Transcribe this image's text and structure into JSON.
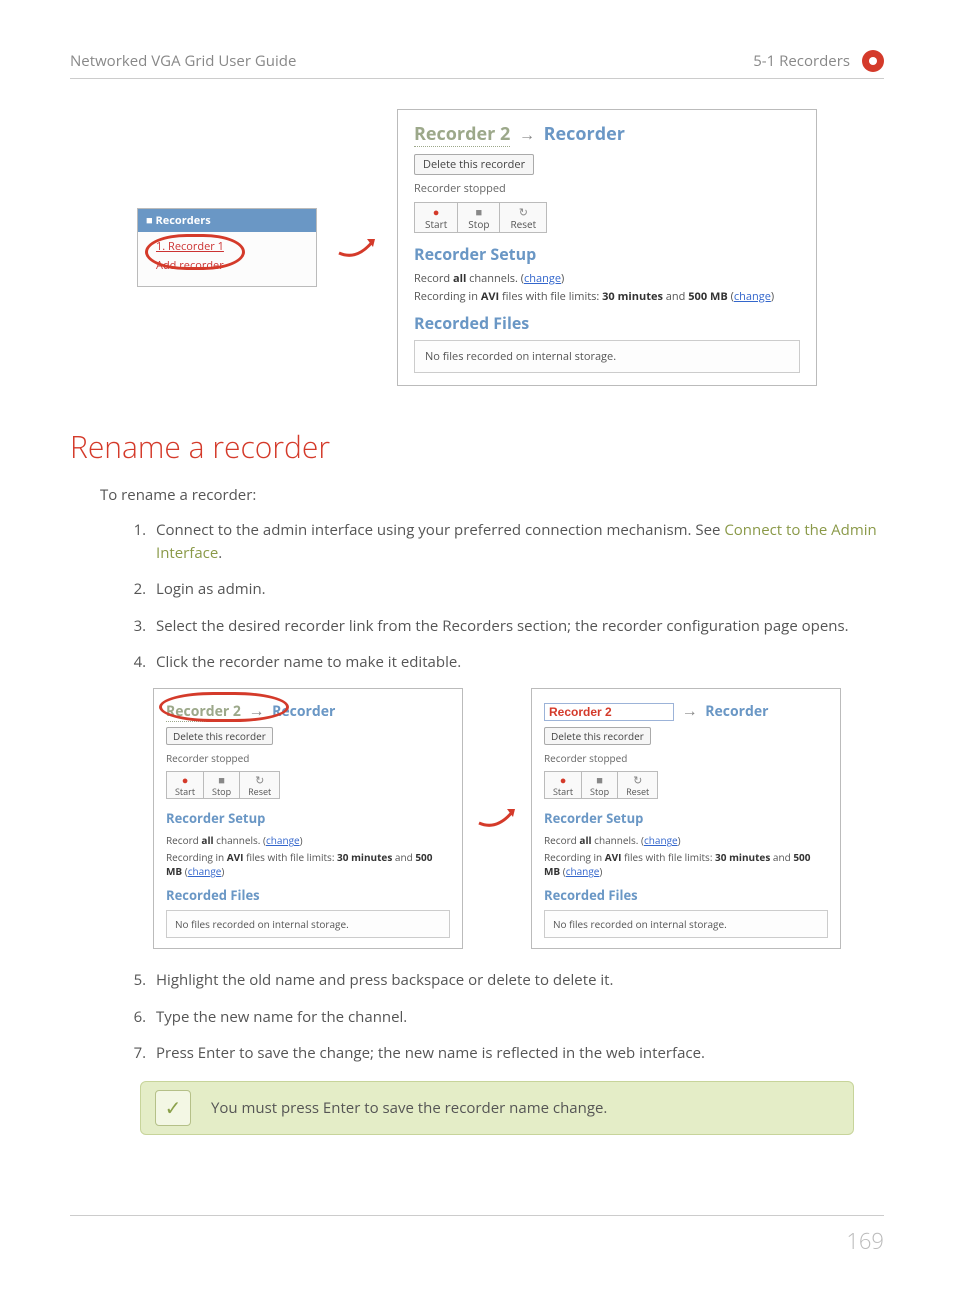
{
  "header": {
    "left": "Networked VGA Grid User Guide",
    "right": "5-1 Recorders"
  },
  "sidebar": {
    "title": "Recorders",
    "item1": "1. Recorder 1",
    "add": "Add recorder"
  },
  "panel": {
    "breadcrumb_link": "Recorder 2",
    "breadcrumb_current": "Recorder",
    "delete_btn": "Delete this recorder",
    "status": "Recorder stopped",
    "start": "Start",
    "stop": "Stop",
    "reset": "Reset",
    "setup_title": "Recorder Setup",
    "line1_a": "Record ",
    "line1_b": "all",
    "line1_c": " channels.  (",
    "change": "change",
    "line1_d": ")",
    "line2_a": "Recording in ",
    "line2_b": "AVI",
    "line2_c": " files with file limits: ",
    "line2_d": "30 minutes",
    "line2_e": " and ",
    "line2_f": "500 MB",
    "line2_g": "  (",
    "line2_h": ")",
    "files_title": "Recorded Files",
    "no_files": "No files recorded on internal storage."
  },
  "edit_value": "Recorder 2",
  "heading": "Rename a recorder",
  "intro": "To rename a recorder:",
  "steps": {
    "s1a": "Connect to the admin interface using your preferred connection mechanism. See ",
    "s1b": "Connect to the Admin Interface",
    "s1c": ".",
    "s2": "Login as admin.",
    "s3": "Select the desired recorder link from the Recorders section; the recorder configuration page opens.",
    "s4": "Click the recorder name to make it editable.",
    "s5": "Highlight the old name and press backspace or delete to delete it.",
    "s6": "Type the new name for the channel.",
    "s7": "Press Enter to save the change; the new name is reflected in the web interface."
  },
  "note": "You must press Enter to save the recorder name change.",
  "pagenum": "169"
}
